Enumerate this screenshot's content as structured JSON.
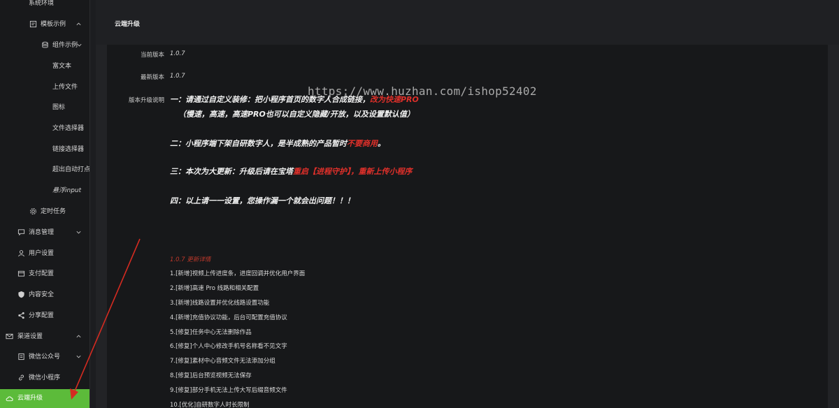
{
  "colors": {
    "accent": "#5cbb3a",
    "highlight_red": "#e0302a",
    "arrow_red": "#d42b21"
  },
  "sidebar": {
    "items": [
      {
        "label": "系统环境",
        "icon": "none"
      },
      {
        "label": "模板示例",
        "icon": "template-icon",
        "chevron": "chevron-up"
      },
      {
        "label": "组件示例",
        "icon": "database-icon",
        "chevron": "chevron-down"
      },
      {
        "label": "富文本"
      },
      {
        "label": "上传文件"
      },
      {
        "label": "图标"
      },
      {
        "label": "文件选择器"
      },
      {
        "label": "链接选择器"
      },
      {
        "label": "超出自动打点"
      },
      {
        "label": "悬浮input"
      },
      {
        "label": "定时任务",
        "icon": "gear-icon"
      },
      {
        "label": "消息管理",
        "icon": "chat-icon",
        "chevron": "chevron-down"
      },
      {
        "label": "用户设置",
        "icon": "user-icon"
      },
      {
        "label": "支付配置",
        "icon": "wallet-icon"
      },
      {
        "label": "内容安全",
        "icon": "shield-icon"
      },
      {
        "label": "分享配置",
        "icon": "share-icon"
      },
      {
        "label": "渠道设置",
        "icon": "mail-icon",
        "chevron": "chevron-up"
      },
      {
        "label": "微信公众号",
        "icon": "document-icon",
        "chevron": "chevron-down"
      },
      {
        "label": "微信小程序",
        "icon": "link-icon"
      },
      {
        "label": "云端升级",
        "icon": "cloud-icon",
        "active": true
      }
    ]
  },
  "main": {
    "title": "云端升级",
    "fields": {
      "current_version_label": "当前版本",
      "current_version": "1.0.7",
      "latest_version_label": "最新版本",
      "latest_version": "1.0.7",
      "notes_label": "版本升级说明"
    },
    "notes": {
      "line1_a": "一：请通过自定义装修：把小程序首页的数字人合成链接，",
      "line1_b": "改为快速PRO",
      "line1_c": "（慢速，高速，高速PRO也可以自定义隐藏/开放，以及设置默认值）",
      "line2_a": "二：小程序端下架自研数字人，是半成熟的产品暂时",
      "line2_b": "不要商用",
      "line2_c": "。",
      "line3_a": "三：本次为大更新：升级后请在宝塔",
      "line3_b": "重启【进程守护】，重新上传小程序",
      "line4": "四：以上请一一设置，您操作漏一个就会出问题！！！"
    },
    "watermark": "https://www.huzhan.com/ishop52402",
    "changelog": {
      "title": "1.0.7 更新详情",
      "items": [
        "1.[新增]视频上传进度条，进度回调并优化用户界面",
        "2.[新增]高速 Pro 线路和相关配置",
        "3.[新增]线路设置并优化线路设置功能",
        "4.[新增]充值协议功能，后台可配置充值协议",
        "5.[修复]任务中心无法删除作品",
        "6.[修复]个人中心修改手机号名称看不见文字",
        "7.[修复]素材中心音频文件无法添加分组",
        "8.[修复]后台预览视频无法保存",
        "9.[修复]部分手机无法上传大写后缀音频文件",
        "10.[优化]自研数字人时长限制"
      ]
    }
  }
}
